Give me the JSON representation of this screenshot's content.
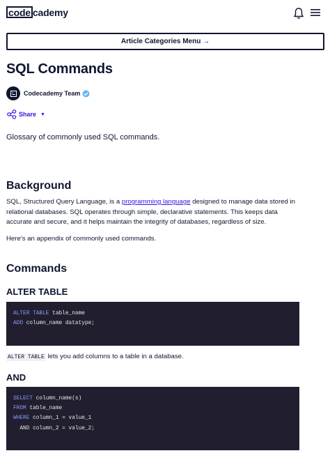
{
  "header": {
    "logo_box": "code",
    "logo_rest": "cademy",
    "icons": [
      "bell-icon",
      "hamburger-menu-icon"
    ]
  },
  "categories_button": {
    "label": "Article Categories Menu →"
  },
  "article": {
    "title": "SQL Commands",
    "author": "Codecademy Team",
    "share_label": "Share",
    "intro": "Glossary of commonly used SQL commands."
  },
  "background": {
    "heading": "Background",
    "p1_a": "SQL, Structured Query Language, is a ",
    "p1_link": "programming language",
    "p1_b": " designed to manage data stored in relational databases. SQL operates through simple, declarative statements. This keeps data accurate and secure, and it helps maintain the integrity of databases, regardless of size.",
    "p2": "Here’s an appendix of commonly used commands."
  },
  "commands": {
    "heading": "Commands",
    "alter": {
      "heading": "ALTER TABLE",
      "code": [
        {
          "kw": "ALTER TABLE",
          "rest": " table_name"
        },
        {
          "kw": "ADD",
          "rest": " column_name datatype;"
        }
      ],
      "desc_code": "ALTER TABLE",
      "desc_rest": " lets you add columns to a table in a database."
    },
    "and": {
      "heading": "AND",
      "code": [
        {
          "kw": "SELECT",
          "rest": " column_name(s)"
        },
        {
          "kw": "FROM",
          "rest": " table_name"
        },
        {
          "kw": "WHERE",
          "rest": " column_1 = value_1"
        },
        {
          "kw": "",
          "rest": "  AND column_2 = value_2;"
        }
      ]
    }
  },
  "colors": {
    "text": "#10162f",
    "link": "#3a10e5",
    "code_bg": "#211e2f",
    "keyword": "#8a9cff",
    "verified": "#6ab4f0"
  }
}
